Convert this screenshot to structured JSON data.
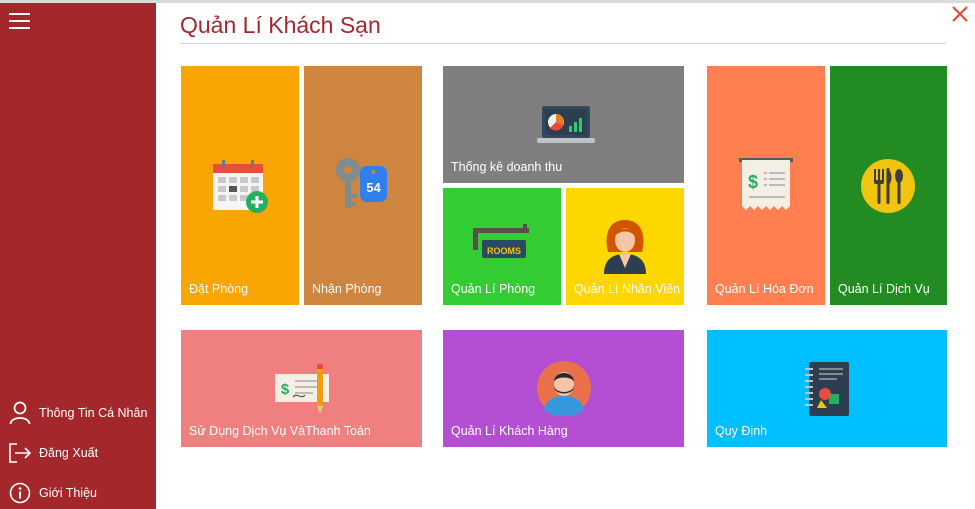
{
  "app": {
    "title": "Quản Lí Khách Sạn"
  },
  "sidebar": {
    "items": [
      {
        "label": "Thông Tin Cá Nhân",
        "icon": "user-icon"
      },
      {
        "label": "Đăng Xuất",
        "icon": "logout-icon"
      },
      {
        "label": "Giới Thiệu",
        "icon": "info-icon"
      }
    ]
  },
  "tiles": {
    "dat_phong": {
      "label": "Đặt Phòng",
      "color": "#f9a602",
      "icon": "calendar-add-icon"
    },
    "nhan_phong": {
      "label": "Nhận Phòng",
      "color": "#cd853f",
      "icon": "room-key-icon"
    },
    "thong_ke": {
      "label": "Thống kê doanh thu",
      "color": "#7f7f7f",
      "icon": "laptop-chart-icon"
    },
    "quan_li_phong": {
      "label": "Quản Lí Phòng",
      "color": "#33cc33",
      "icon": "rooms-sign-icon"
    },
    "quan_li_nhan_vien": {
      "label": "Quản Lí Nhân Viên",
      "color": "#ffd700",
      "icon": "employee-icon"
    },
    "quan_li_hoa_don": {
      "label": "Quản Lí Hóa Đơn",
      "color": "#ff7f50",
      "icon": "receipt-icon"
    },
    "quan_li_dich_vu": {
      "label": "Quản Lí Dịch Vụ",
      "color": "#228b22",
      "icon": "cutlery-icon"
    },
    "su_dung_dich_vu": {
      "label": "Sử Dụng Dịch Vụ VàThanh Toán",
      "color": "#f08080",
      "icon": "cheque-pen-icon"
    },
    "quan_li_khach_hang": {
      "label": "Quản Lí Khách Hàng",
      "color": "#b44fd3",
      "icon": "customer-avatar-icon"
    },
    "quy_dinh": {
      "label": "Quy Định",
      "color": "#00bfff",
      "icon": "notebook-icon"
    }
  },
  "colors": {
    "sidebar": "#a4282b",
    "title": "#a4282b",
    "close": "#e8442a"
  }
}
